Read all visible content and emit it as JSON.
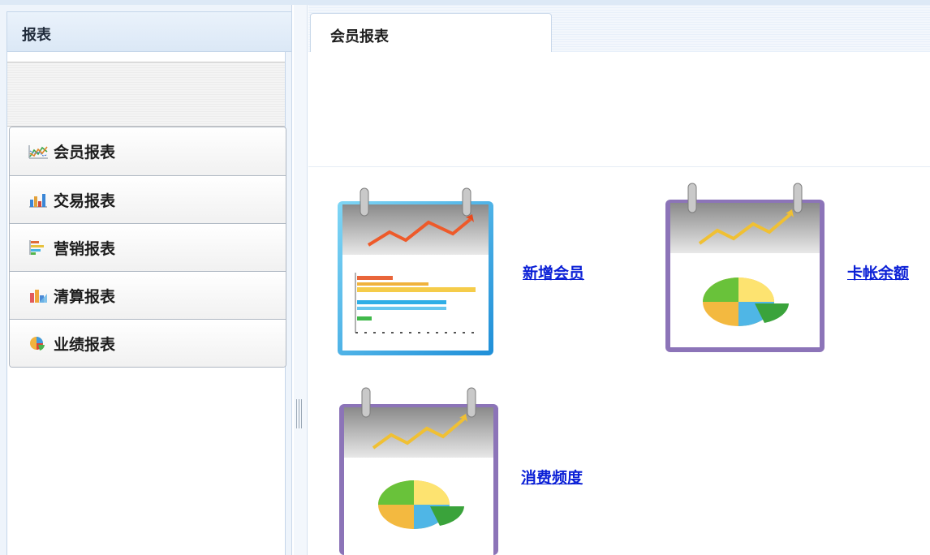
{
  "sidebar": {
    "title": "报表",
    "items": [
      {
        "label": "会员报表",
        "icon": "line-chart-icon"
      },
      {
        "label": "交易报表",
        "icon": "bar-chart-icon"
      },
      {
        "label": "营销报表",
        "icon": "horizontal-bar-chart-icon"
      },
      {
        "label": "清算报表",
        "icon": "column-chart-icon"
      },
      {
        "label": "业绩报表",
        "icon": "pie-chart-icon"
      }
    ]
  },
  "tabs": [
    {
      "label": "会员报表",
      "active": true
    }
  ],
  "reports": [
    {
      "label": "新增会员",
      "icon": "calendar-bar-chart-icon"
    },
    {
      "label": "卡帐余额",
      "icon": "calendar-pie-chart-icon"
    },
    {
      "label": "消费频度",
      "icon": "calendar-pie-chart-icon"
    }
  ],
  "colors": {
    "link": "#0a1fd6",
    "panel_bg": "#eef4fb",
    "border": "#c9d8ea"
  }
}
